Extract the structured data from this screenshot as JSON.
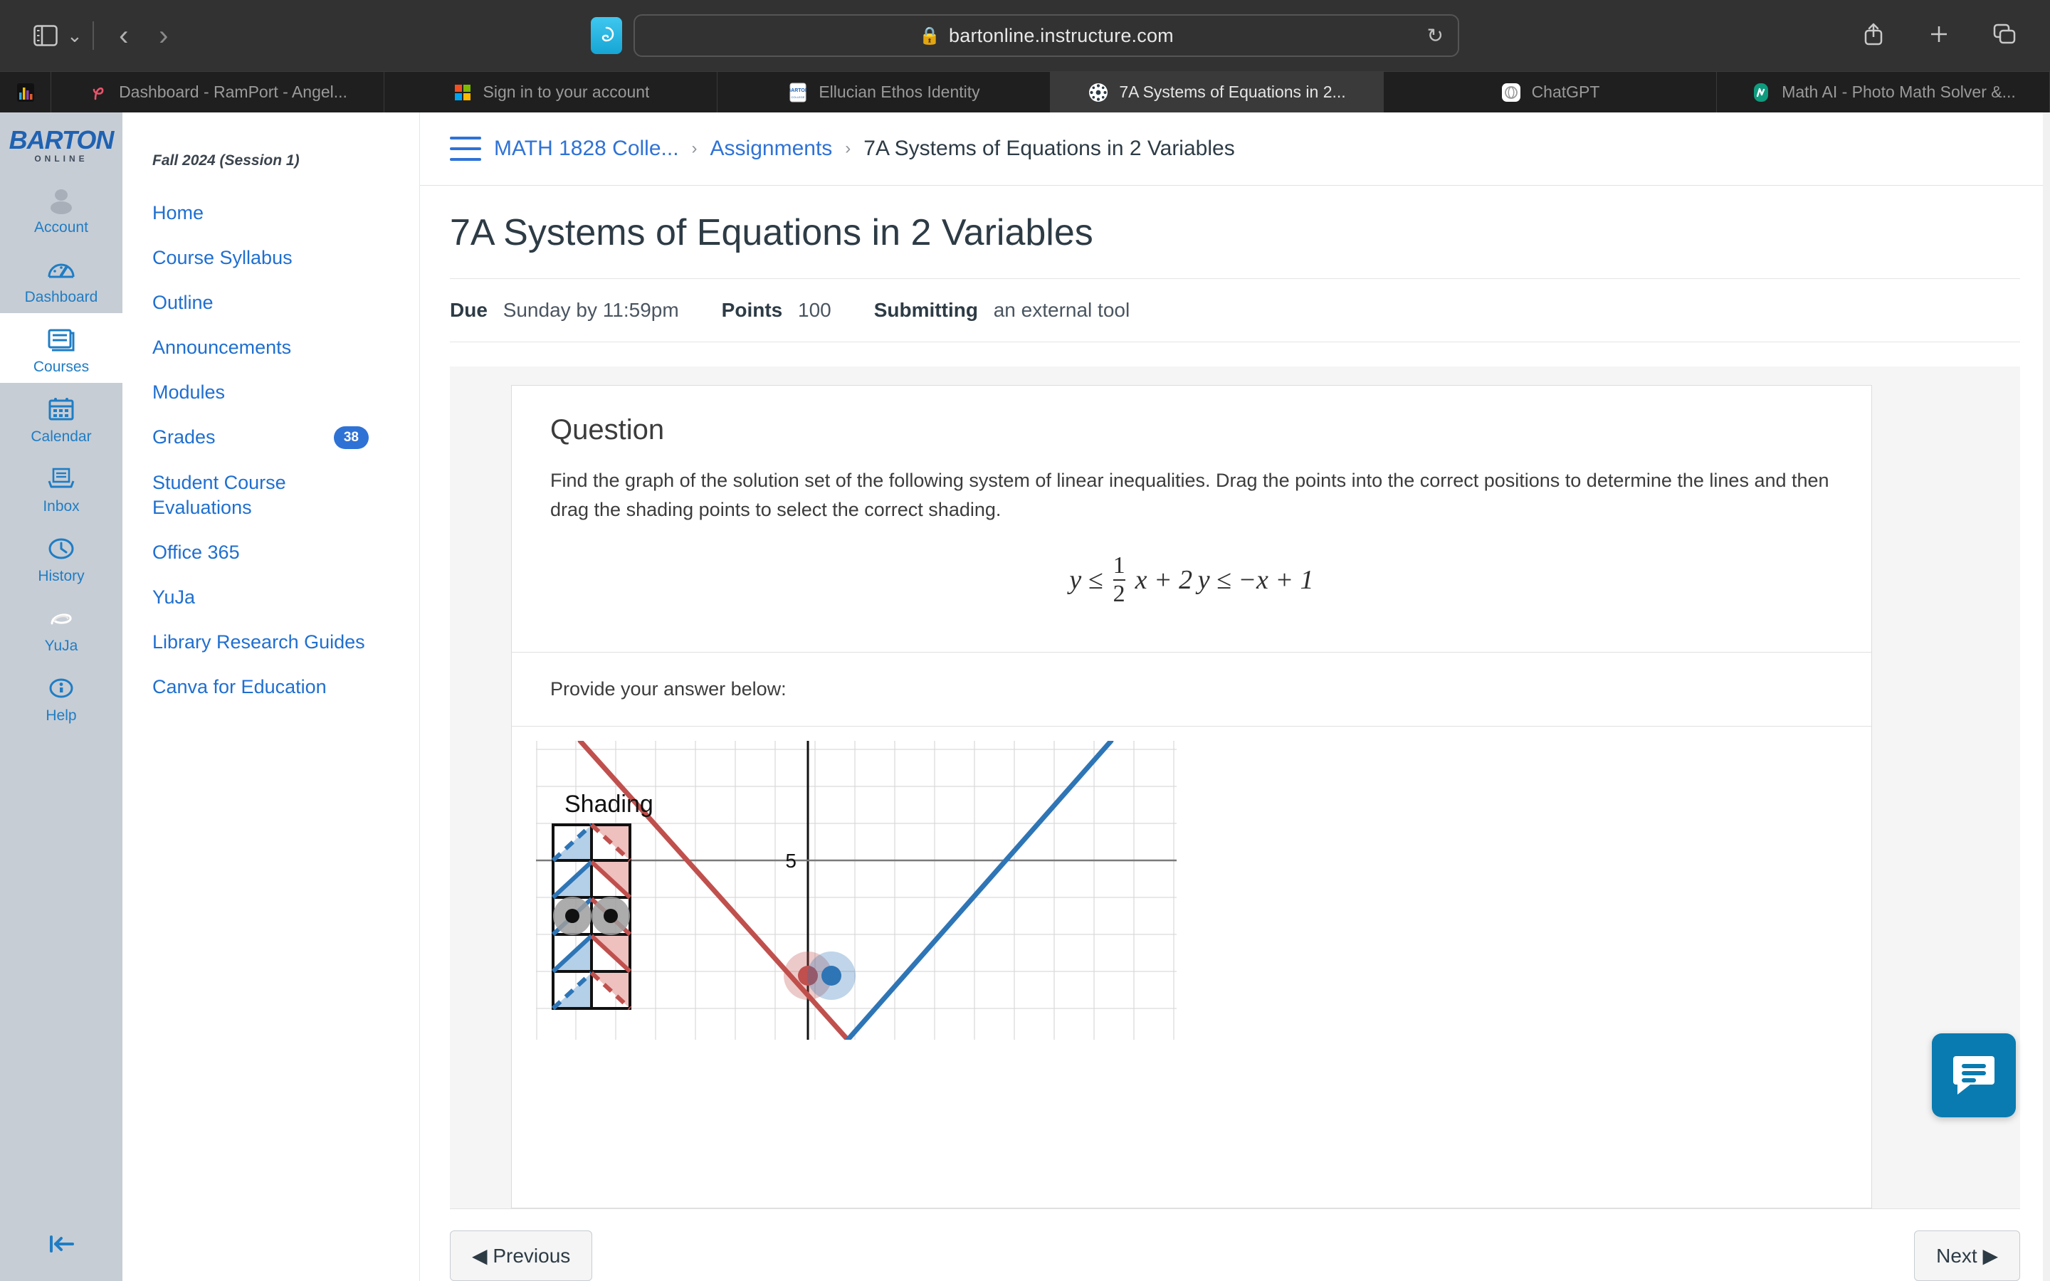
{
  "browser": {
    "url": "bartonline.instructure.com",
    "lock_icon": "lock-icon",
    "reload_icon": "reload-icon",
    "sidebar_icon": "sidebar-toggle-icon",
    "back_icon": "back-arrow-icon",
    "forward_icon": "forward-arrow-icon",
    "share_icon": "share-icon",
    "newtab_icon": "plus-icon",
    "taboverview_icon": "tab-overview-icon",
    "extension_icon": "extension-icon",
    "tabs": [
      {
        "label": "",
        "icon": "chart-bars-favicon",
        "pinned": true,
        "active": false
      },
      {
        "label": "Dashboard - RamPort - Angel...",
        "icon": "ramport-favicon",
        "pinned": false,
        "active": false
      },
      {
        "label": "Sign in to your account",
        "icon": "microsoft-favicon",
        "pinned": false,
        "active": false
      },
      {
        "label": "Ellucian Ethos Identity",
        "icon": "barton-favicon",
        "pinned": false,
        "active": false
      },
      {
        "label": "7A Systems of Equations in 2...",
        "icon": "canvas-favicon",
        "pinned": false,
        "active": true
      },
      {
        "label": "ChatGPT",
        "icon": "chatgpt-favicon",
        "pinned": false,
        "active": false
      },
      {
        "label": "Math AI - Photo Math Solver &...",
        "icon": "mathai-favicon",
        "pinned": false,
        "active": false
      }
    ]
  },
  "global_nav": {
    "brand": {
      "word": "BARTON",
      "sub": "ONLINE"
    },
    "collapse_icon": "collapse-sidebar-icon",
    "items": [
      {
        "label": "Account",
        "icon": "account-avatar-icon",
        "active": false
      },
      {
        "label": "Dashboard",
        "icon": "dashboard-gauge-icon",
        "active": false
      },
      {
        "label": "Courses",
        "icon": "courses-book-icon",
        "active": true
      },
      {
        "label": "Calendar",
        "icon": "calendar-icon",
        "active": false
      },
      {
        "label": "Inbox",
        "icon": "inbox-tray-icon",
        "active": false
      },
      {
        "label": "History",
        "icon": "history-clock-icon",
        "active": false
      },
      {
        "label": "YuJa",
        "icon": "yuja-swirl-icon",
        "active": false
      },
      {
        "label": "Help",
        "icon": "help-info-icon",
        "active": false
      }
    ]
  },
  "course_nav": {
    "term": "Fall 2024 (Session 1)",
    "items": [
      {
        "label": "Home",
        "badge": ""
      },
      {
        "label": "Course Syllabus",
        "badge": ""
      },
      {
        "label": "Outline",
        "badge": ""
      },
      {
        "label": "Announcements",
        "badge": ""
      },
      {
        "label": "Modules",
        "badge": ""
      },
      {
        "label": "Grades",
        "badge": "38"
      },
      {
        "label": "Student Course Evaluations",
        "badge": ""
      },
      {
        "label": "Office 365",
        "badge": ""
      },
      {
        "label": "YuJa",
        "badge": ""
      },
      {
        "label": "Library Research Guides",
        "badge": ""
      },
      {
        "label": "Canva for Education",
        "badge": ""
      }
    ]
  },
  "breadcrumb": {
    "menu_icon": "hamburger-menu-icon",
    "course": "MATH 1828 Colle...",
    "section": "Assignments",
    "current": "7A Systems of Equations in 2 Variables",
    "separator": "›"
  },
  "assignment": {
    "title": "7A Systems of Equations in 2 Variables",
    "due_label": "Due",
    "due_value": "Sunday by 11:59pm",
    "points_label": "Points",
    "points_value": "100",
    "submitting_label": "Submitting",
    "submitting_value": "an external tool"
  },
  "question": {
    "heading": "Question",
    "prompt": "Find the graph of the solution set of the following system of linear inequalities. Drag the points into the correct positions to determine the lines and then drag the shading points to select the correct shading.",
    "equation1": {
      "lhs": "y ≤",
      "num": "1",
      "den": "2",
      "rest": "x + 2"
    },
    "equation2": "y ≤ −x + 1",
    "answer_label": "Provide your answer below:"
  },
  "chart_data": {
    "type": "line",
    "title": "",
    "xlabel": "",
    "ylabel": "",
    "grid": true,
    "legend": "none",
    "xlim": [
      -1,
      11
    ],
    "ylim": [
      -1,
      7
    ],
    "axis_tick_label": "5",
    "series": [
      {
        "name": "red-line",
        "color": "#c0504d",
        "equation": "y = -x + 1 (drawn descending)",
        "points": [
          {
            "x": -0.3,
            "y": 7.0
          },
          {
            "x": 5.55,
            "y": -0.6
          }
        ],
        "handle": {
          "x": 4.75,
          "y": 1.0,
          "color": "#c0504d",
          "halo": "#e8b4b2"
        }
      },
      {
        "name": "blue-line",
        "color": "#2e75b6",
        "equation": "y = 0.5x + 2 (drawn ascending)",
        "points": [
          {
            "x": 5.55,
            "y": -0.6
          },
          {
            "x": 10.4,
            "y": 7.0
          }
        ],
        "handle": {
          "x": 6.45,
          "y": 1.0,
          "color": "#2e75b6",
          "halo": "#b3cfe8"
        }
      }
    ],
    "shading_palette": {
      "label": "Shading",
      "columns": [
        "blue",
        "red"
      ],
      "rows": 5,
      "selected_row_index": 2,
      "blue_color": "#b4cfe8",
      "red_color": "#eec0be",
      "handle_color": "#9e9e9e"
    }
  },
  "footer": {
    "previous": "Previous",
    "previous_icon": "left-caret-icon",
    "next": "Next",
    "next_icon": "right-caret-icon"
  },
  "chat": {
    "icon": "chat-bubble-icon",
    "color": "#0a7bb0"
  }
}
